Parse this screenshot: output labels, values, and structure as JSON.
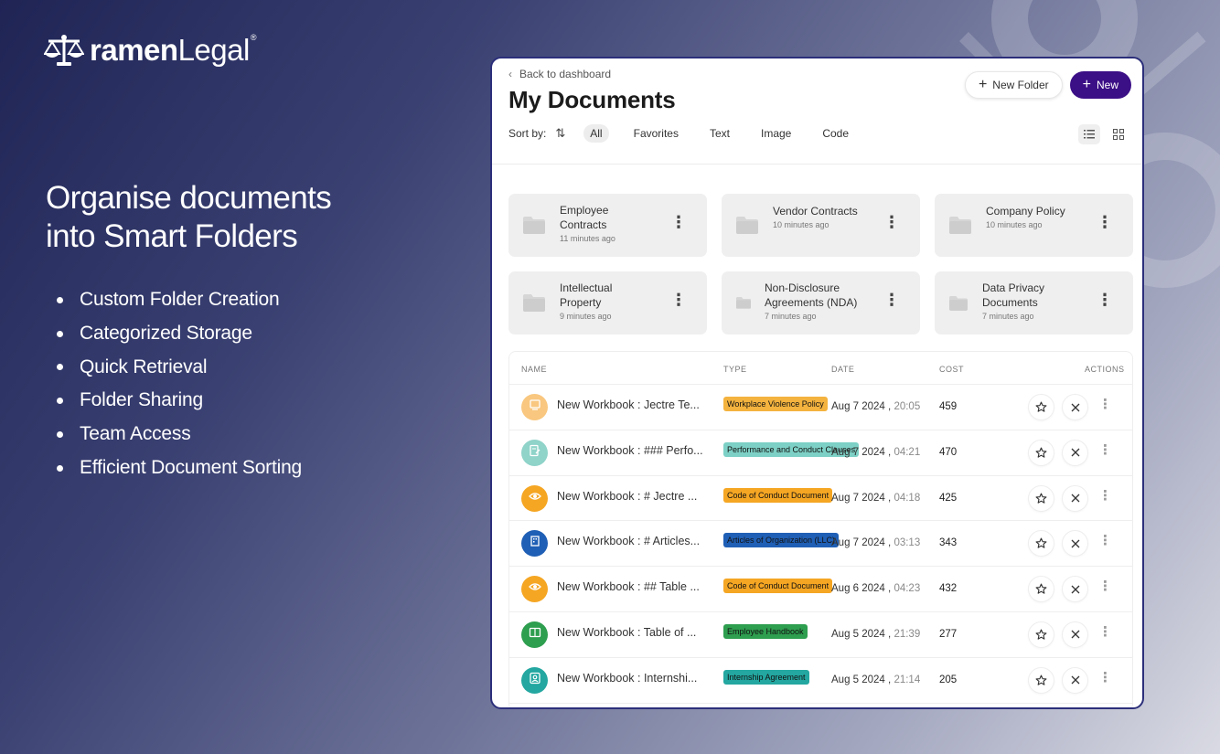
{
  "brand": {
    "name_bold": "ramen",
    "name_light": "Legal",
    "reg": "®"
  },
  "headline": {
    "line1": "Organise documents",
    "line2": "into Smart Folders"
  },
  "features": [
    "Custom Folder Creation",
    "Categorized Storage",
    "Quick Retrieval",
    "Folder Sharing",
    "Team Access",
    "Efficient Document Sorting"
  ],
  "app": {
    "back_label": "Back to dashboard",
    "title": "My Documents",
    "new_folder_label": "New Folder",
    "new_label": "New",
    "sort_label": "Sort by:",
    "filters": [
      "All",
      "Favorites",
      "Text",
      "Image",
      "Code"
    ],
    "folders": [
      {
        "name1": "Employee",
        "name2": "Contracts",
        "time": "11 minutes ago"
      },
      {
        "name1": "Vendor Contracts",
        "name2": "",
        "time": "10 minutes ago"
      },
      {
        "name1": "Company Policy",
        "name2": "",
        "time": "10 minutes ago"
      },
      {
        "name1": "Intellectual",
        "name2": "Property",
        "time": "9 minutes ago"
      },
      {
        "name1": "Non-Disclosure",
        "name2": "Agreements (NDA)",
        "time": "7 minutes ago"
      },
      {
        "name1": "Data Privacy",
        "name2": "Documents",
        "time": "7 minutes ago"
      }
    ],
    "table": {
      "headers": {
        "name": "NAME",
        "type": "TYPE",
        "date": "DATE",
        "cost": "COST",
        "actions": "ACTIONS"
      },
      "rows": [
        {
          "name": "New Workbook : Jectre Te...",
          "type": "Workplace Violence Policy",
          "date": "Aug 7 2024",
          "time": "20:05",
          "cost": "459",
          "avatar_color": "#f9c77f",
          "tag_color": "#f4b33e",
          "icon": "document-icon"
        },
        {
          "name": "New Workbook : ### Perfo...",
          "type": "Performance and Conduct Clauses",
          "date": "Aug 7 2024",
          "time": "04:21",
          "cost": "470",
          "avatar_color": "#8fd3c9",
          "tag_color": "#7dd0c5",
          "icon": "edit-document-icon"
        },
        {
          "name": "New Workbook : # Jectre ...",
          "type": "Code of Conduct Document",
          "date": "Aug 7 2024",
          "time": "04:18",
          "cost": "425",
          "avatar_color": "#f5a623",
          "tag_color": "#f5a623",
          "icon": "eye-icon"
        },
        {
          "name": "New Workbook : # Articles...",
          "type": "Articles of Organization (LLC)",
          "date": "Aug 7 2024",
          "time": "03:13",
          "cost": "343",
          "avatar_color": "#1f5fb5",
          "tag_color": "#1f5fb5",
          "icon": "building-icon"
        },
        {
          "name": "New Workbook : ## Table ...",
          "type": "Code of Conduct Document",
          "date": "Aug 6 2024",
          "time": "04:23",
          "cost": "432",
          "avatar_color": "#f5a623",
          "tag_color": "#f5a623",
          "icon": "eye-icon"
        },
        {
          "name": "New Workbook : Table of ...",
          "type": "Employee Handbook",
          "date": "Aug 5 2024",
          "time": "21:39",
          "cost": "277",
          "avatar_color": "#2e9e4f",
          "tag_color": "#2e9e4f",
          "icon": "book-icon"
        },
        {
          "name": "New Workbook : Internshi...",
          "type": "Internship Agreement",
          "date": "Aug 5 2024",
          "time": "21:14",
          "cost": "205",
          "avatar_color": "#23a7a0",
          "tag_color": "#23a7a0",
          "icon": "user-badge-icon"
        }
      ]
    }
  },
  "colors": {
    "primary": "#3b0f86",
    "folder_bg": "#efefef"
  }
}
